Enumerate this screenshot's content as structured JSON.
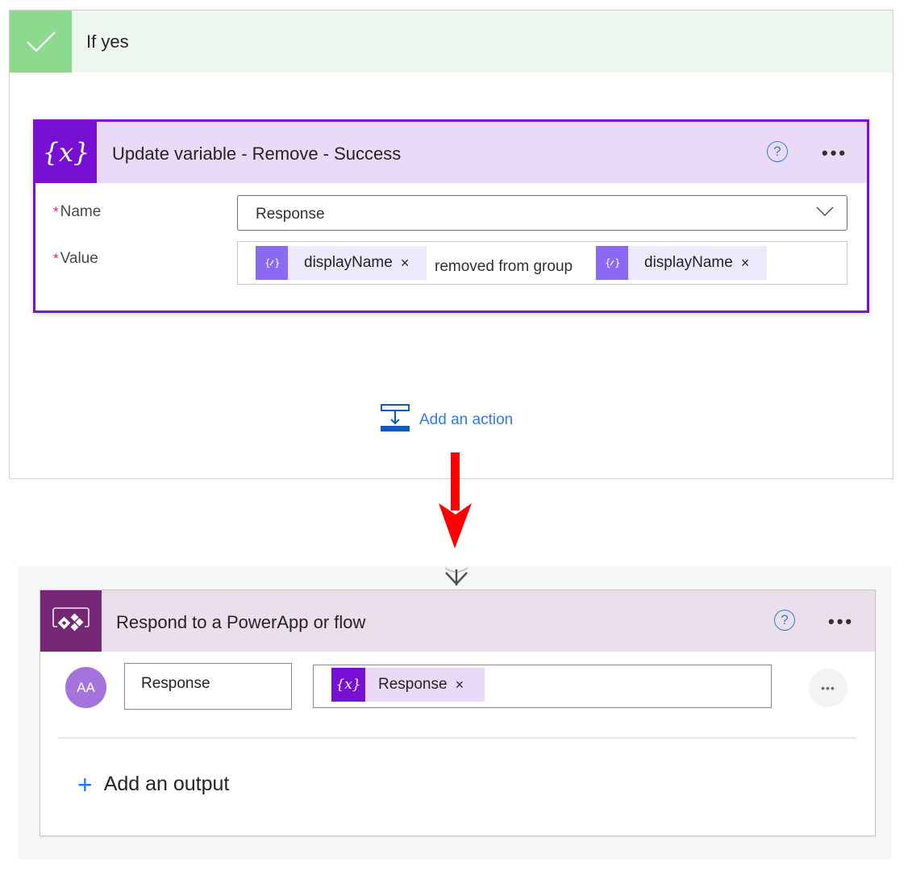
{
  "condition_branch": {
    "title": "If yes",
    "icon": "checkmark-icon",
    "colors": {
      "header_bg": "#edf7ee",
      "icon_bg": "#8cda8e"
    }
  },
  "update_variable_action": {
    "title": "Update variable - Remove - Success",
    "icon": "variable-icon",
    "icon_glyph": "{x}",
    "help_icon_glyph": "?",
    "more_glyph": "•••",
    "colors": {
      "header_bg": "#ebdaf7",
      "icon_bg": "#7710d2",
      "border": "#7d10d2"
    },
    "fields": {
      "name": {
        "label": "Name",
        "required_mark": "*",
        "value": "Response"
      },
      "value": {
        "label": "Value",
        "required_mark": "*",
        "tokens": [
          {
            "type": "dynamic",
            "label": "displayName",
            "remove_glyph": "×"
          },
          {
            "type": "text",
            "label": "removed from group"
          },
          {
            "type": "dynamic",
            "label": "displayName",
            "remove_glyph": "×"
          }
        ]
      }
    }
  },
  "add_action": {
    "label": "Add an action",
    "icon": "add-action-icon"
  },
  "respond_action": {
    "title": "Respond to a PowerApp or flow",
    "icon": "powerapps-icon",
    "help_icon_glyph": "?",
    "more_glyph": "•••",
    "colors": {
      "header_bg": "#ebdfeb",
      "icon_bg": "#742774"
    },
    "outputs": [
      {
        "type_avatar": "AA",
        "name": "Response",
        "value_token": {
          "icon_glyph": "{x}",
          "label": "Response",
          "remove_glyph": "×"
        },
        "row_more_glyph": "•••"
      }
    ],
    "add_output": {
      "plus": "+",
      "label": "Add an output"
    }
  },
  "annotation": {
    "arrow_color": "#ff0000",
    "direction": "down"
  }
}
